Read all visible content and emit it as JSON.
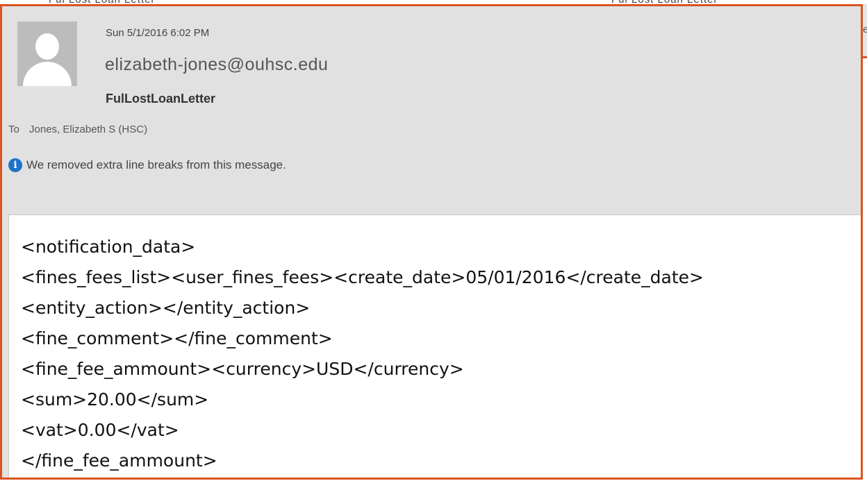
{
  "email": {
    "datetime": "Sun 5/1/2016 6:02 PM",
    "from": "elizabeth-jones@ouhsc.edu",
    "subject": "FulLostLoanLetter",
    "to_label": "To",
    "to": "Jones, Elizabeth S (HSC)",
    "info_message": "We removed extra line breaks from this message."
  },
  "body_lines": [
    "<notification_data>",
    "<fines_fees_list><user_fines_fees><create_date>05/01/2016</create_date>",
    "<entity_action></entity_action>",
    "<fine_comment></fine_comment>",
    "<fine_fee_ammount><currency>USD</currency>",
    "<sum>20.00</sum>",
    "<vat>0.00</vat>",
    "</fine_fee_ammount>"
  ],
  "icons": {
    "info": "info-icon",
    "avatar": "person-silhouette"
  },
  "colors": {
    "highlight_frame": "#d9541e",
    "header_bg": "#e1e1e1",
    "info_icon": "#1e73c9"
  }
}
